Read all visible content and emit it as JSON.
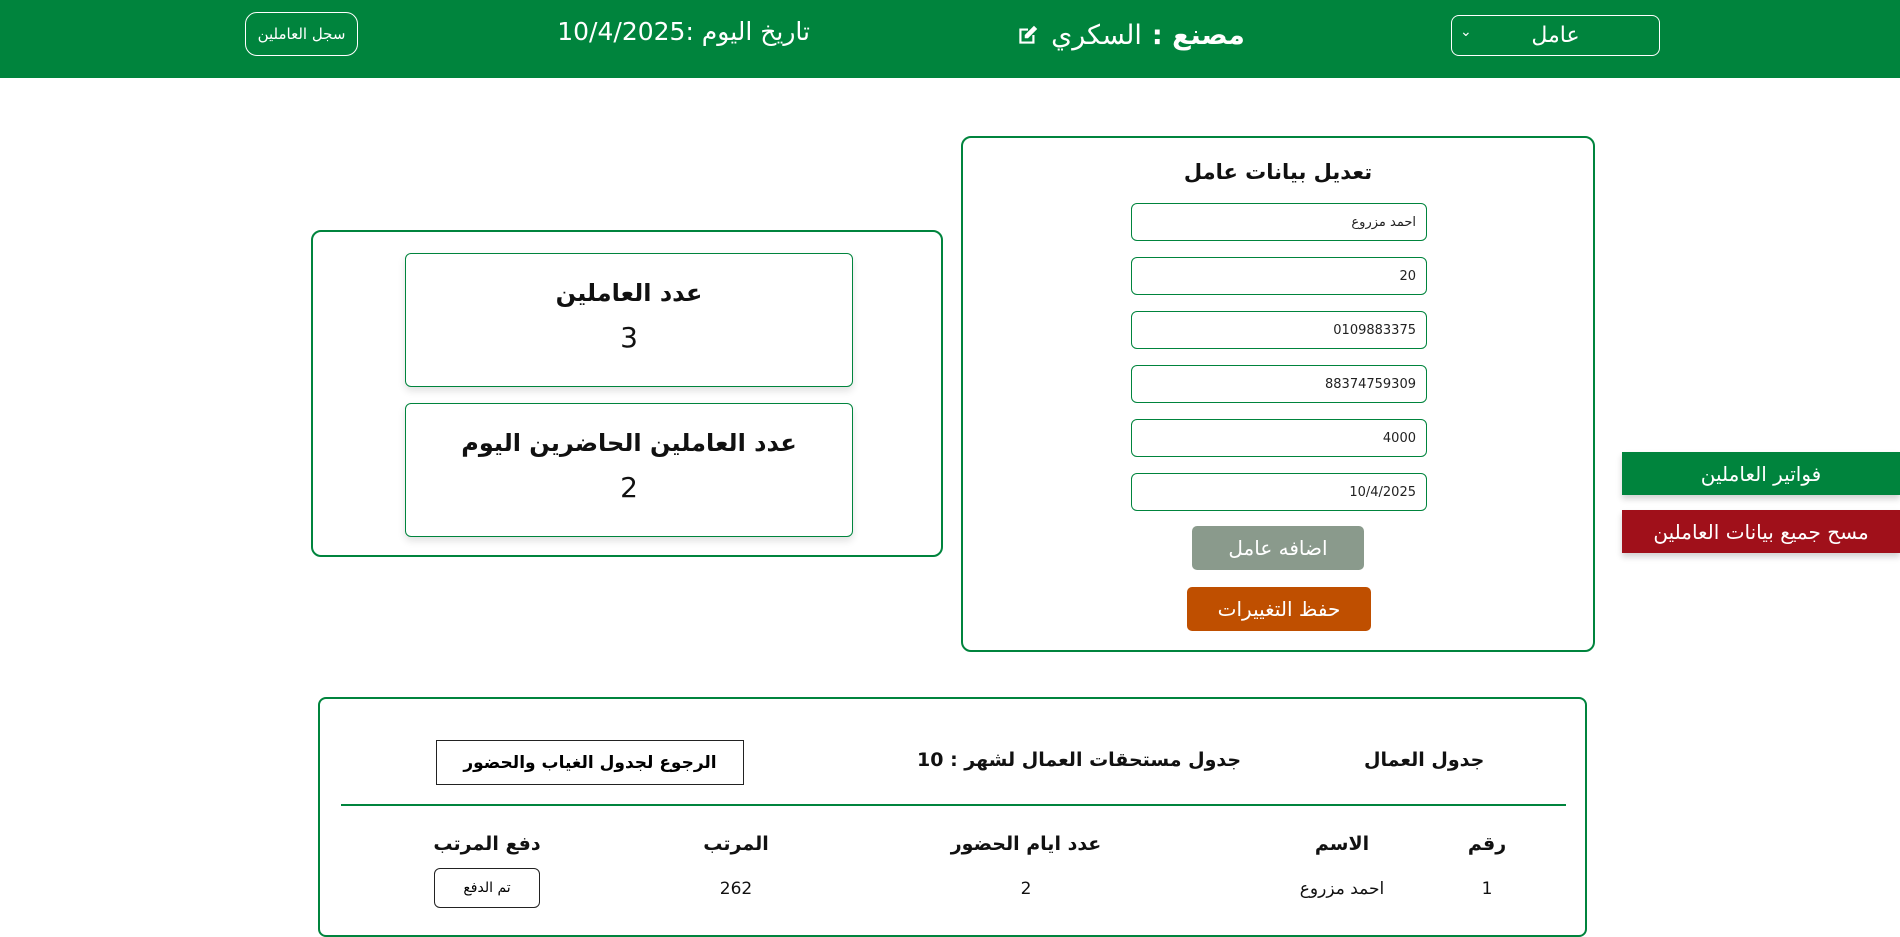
{
  "header": {
    "log_button": "سجل العاملين",
    "date_text": "تاريخ اليوم :10/4/2025",
    "factory_label": "مصنع :",
    "factory_name": "السكري",
    "role_select": "عامل",
    "bar_color": "#00843d"
  },
  "stats": {
    "workers_title": "عدد العاملين",
    "workers_count": "3",
    "present_title": "عدد العاملين الحاضرين اليوم",
    "present_count": "2"
  },
  "edit_form": {
    "title": "تعديل بيانات عامل",
    "name_value": "احمد مزروع",
    "age_value": "20",
    "phone_value": "0109883375",
    "national_id_value": "88374759309",
    "salary_value": "4000",
    "date_value": "10/4/2025",
    "add_button": "اضافه عامل",
    "save_button": "حفظ التغييرات"
  },
  "side_buttons": {
    "invoices": "فواتير العاملين",
    "delete_all": "مسح جميع بيانات العاملين"
  },
  "table_panel": {
    "workers_table_title": "جدول العمال",
    "dues_title": "جدول مستحقات العمال لشهر : 10",
    "back_button": "الرجوع لجدول الغياب والحضور",
    "columns": [
      "رقم",
      "الاسم",
      "عدد ايام الحضور",
      "المرتب",
      "دفع المرتب"
    ],
    "rows": [
      {
        "num": "1",
        "name": "احمد مزروع",
        "days": "2",
        "salary": "262",
        "pay": "تم الدفع"
      }
    ]
  },
  "icons": {
    "edit": "edit-icon",
    "chevron": "chevron-down-icon"
  }
}
